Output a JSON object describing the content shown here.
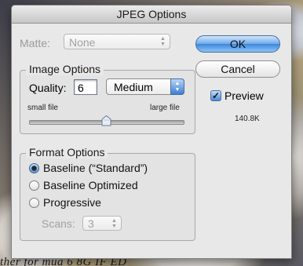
{
  "dialog": {
    "title": "JPEG Options",
    "matte": {
      "label": "Matte:",
      "value": "None"
    },
    "image_options": {
      "title": "Image Options",
      "quality_label": "Quality:",
      "quality_value": "6",
      "quality_preset": "Medium",
      "small_label": "small file",
      "large_label": "large file",
      "slider_fraction": 0.5
    },
    "format_options": {
      "title": "Format Options",
      "options": [
        {
          "label": "Baseline (“Standard”)",
          "selected": true
        },
        {
          "label": "Baseline Optimized",
          "selected": false
        },
        {
          "label": "Progressive",
          "selected": false
        }
      ],
      "scans_label": "Scans:",
      "scans_value": "3"
    },
    "buttons": {
      "ok": "OK",
      "cancel": "Cancel"
    },
    "preview": {
      "label": "Preview",
      "checked": true,
      "size": "140.8K"
    }
  },
  "background": {
    "caption": "ther for mua 6 8G IF ED"
  },
  "colors": {
    "accent": "#3c87dd",
    "dialog_bg": "#e8e8e8"
  }
}
